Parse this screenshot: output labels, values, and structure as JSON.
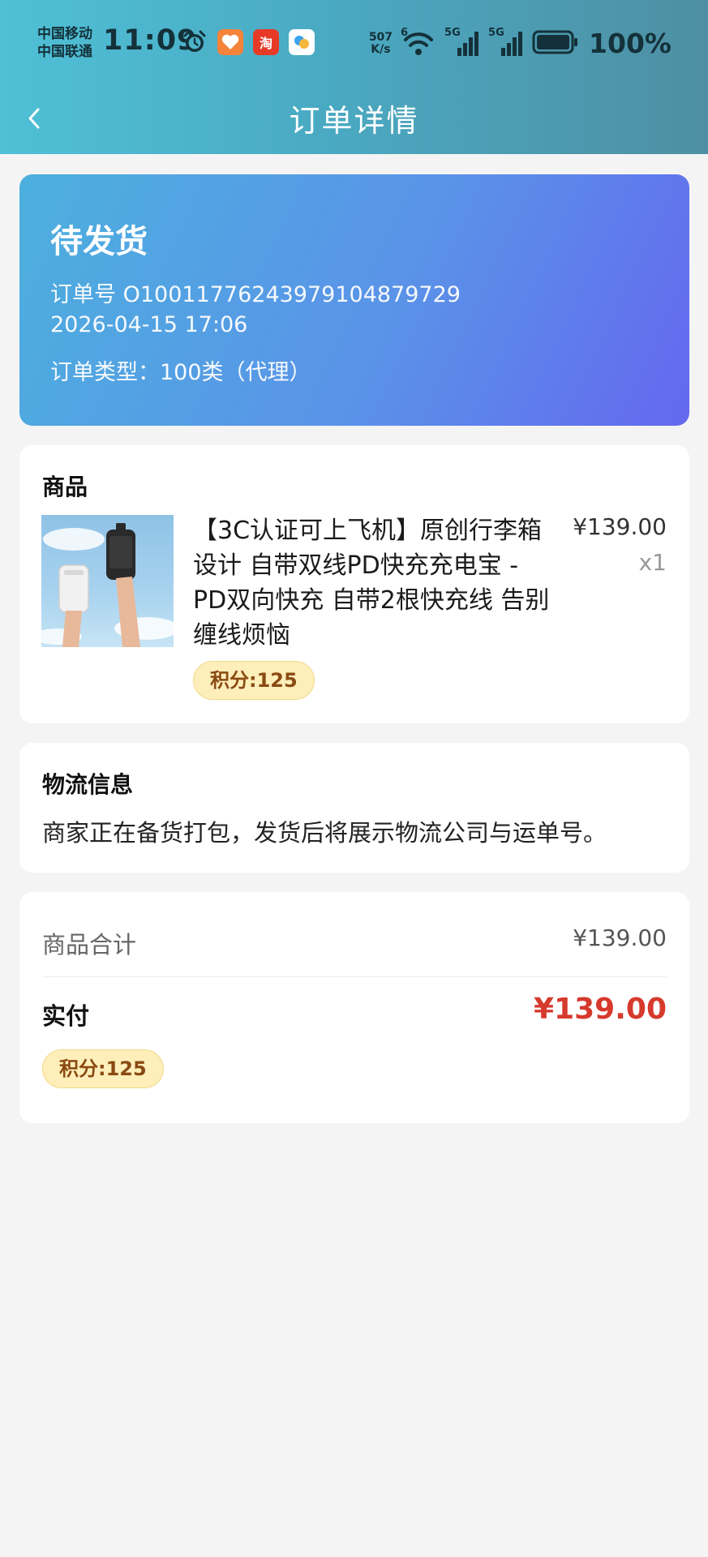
{
  "status_bar": {
    "carrier_1": "中国移动",
    "carrier_2": "中国联通",
    "time": "11:09",
    "net_speed_value": "507",
    "net_speed_unit": "K/s",
    "signal_1_label": "5G",
    "signal_2_label": "5G",
    "wifi_label": "6",
    "taobao_glyph": "淘",
    "battery": "100%",
    "notification_icons": [
      "alarm-icon",
      "health-app-icon",
      "taobao-app-icon",
      "alipay-app-icon"
    ]
  },
  "nav": {
    "title": "订单详情",
    "back_icon": "chevron-left-icon"
  },
  "order": {
    "status": "待发货",
    "order_number_label": "订单号",
    "order_number": "O100117762439791048797​29",
    "datetime": "2026-04-15 17:06",
    "type_label": "订单类型：",
    "type_value": "100类（代理）"
  },
  "product_section": {
    "title": "商品",
    "name": "【3C认证可上飞机】原创行李箱设计 自带双线PD快充充电宝 - PD双向快充 自带2根快充线 告别缠线烦恼",
    "price": "¥139.00",
    "quantity": "x1",
    "points": "积分:125"
  },
  "logistics": {
    "title": "物流信息",
    "message": "商家正在备货打包，发货后将展示物流公司与运单号。"
  },
  "summary": {
    "subtotal_label": "商品合计",
    "subtotal_value": "¥139.00",
    "paid_label": "实付",
    "paid_value": "¥139.00",
    "points": "积分:125"
  },
  "colors": {
    "header_start": "#4fc0d6",
    "status_card_start": "#4cb0de",
    "status_card_end": "#6468ef",
    "paid_red": "#d63a2c",
    "badge_bg": "#fdeeba",
    "badge_text": "#8a4a12"
  }
}
